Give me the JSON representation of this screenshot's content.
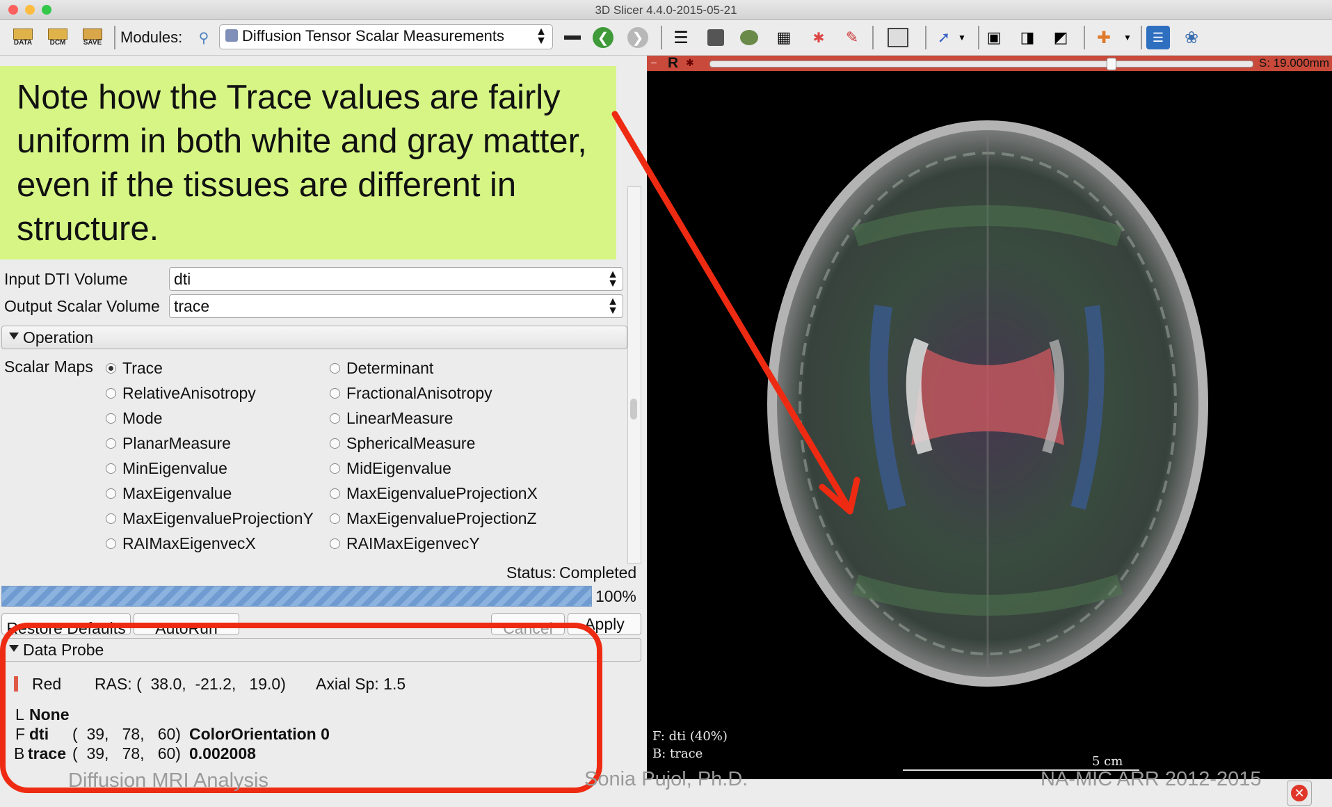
{
  "window": {
    "title": "3D Slicer 4.4.0-2015-05-21"
  },
  "toolbar": {
    "data_label": "DATA",
    "dcm_label": "DCM",
    "save_label": "SAVE",
    "modules_label": "Modules:",
    "module_selected": "Diffusion Tensor Scalar Measurements"
  },
  "annotation": {
    "text": "Note how the Trace values are fairly uniform in both white and gray matter, even if the tissues are different in structure."
  },
  "io": {
    "input_label": "Input DTI Volume",
    "input_value": "dti",
    "output_label": "Output Scalar Volume",
    "output_value": "trace"
  },
  "operation": {
    "section_label": "Operation",
    "scalar_maps_label": "Scalar Maps",
    "options_left": [
      "Trace",
      "RelativeAnisotropy",
      "Mode",
      "PlanarMeasure",
      "MinEigenvalue",
      "MaxEigenvalue",
      "MaxEigenvalueProjectionY",
      "RAIMaxEigenvecX"
    ],
    "options_right": [
      "Determinant",
      "FractionalAnisotropy",
      "LinearMeasure",
      "SphericalMeasure",
      "MidEigenvalue",
      "MaxEigenvalueProjectionX",
      "MaxEigenvalueProjectionZ",
      "RAIMaxEigenvecY"
    ],
    "selected": "Trace"
  },
  "status": {
    "label": "Status:",
    "value": "Completed",
    "progress_text": "100%",
    "progress_fraction": 1.0
  },
  "buttons": {
    "restore": "Restore Defaults",
    "autorun": "AutoRun",
    "cancel": "Cancel",
    "apply": "Apply"
  },
  "probe": {
    "section_label": "Data Probe",
    "view_name": "Red",
    "ras": "RAS: (  38.0,  -21.2,   19.0)",
    "axial": "Axial Sp: 1.5",
    "l_prefix": "L",
    "l_value": "None",
    "f_prefix": "F",
    "f_name": "dti",
    "f_ijk": "(  39,   78,   60)",
    "f_value": "ColorOrientation 0",
    "b_prefix": "B",
    "b_name": "trace",
    "b_ijk": "(  39,   78,   60)",
    "b_value": "0.002008"
  },
  "viewer": {
    "view_letter": "R",
    "offset": "S: 19.000mm",
    "fg_label": "F: dti (40%)",
    "bg_label": "B: trace",
    "scale_label": "5 cm"
  },
  "footer": {
    "left": "Diffusion MRI Analysis",
    "center": "Sonia Pujol, Ph.D.",
    "right": "NA-MIC ARR 2012-2015"
  },
  "colors": {
    "annotation_bg": "#d6f585",
    "highlight": "#ee2b12",
    "arrow": "#ee2b12"
  }
}
